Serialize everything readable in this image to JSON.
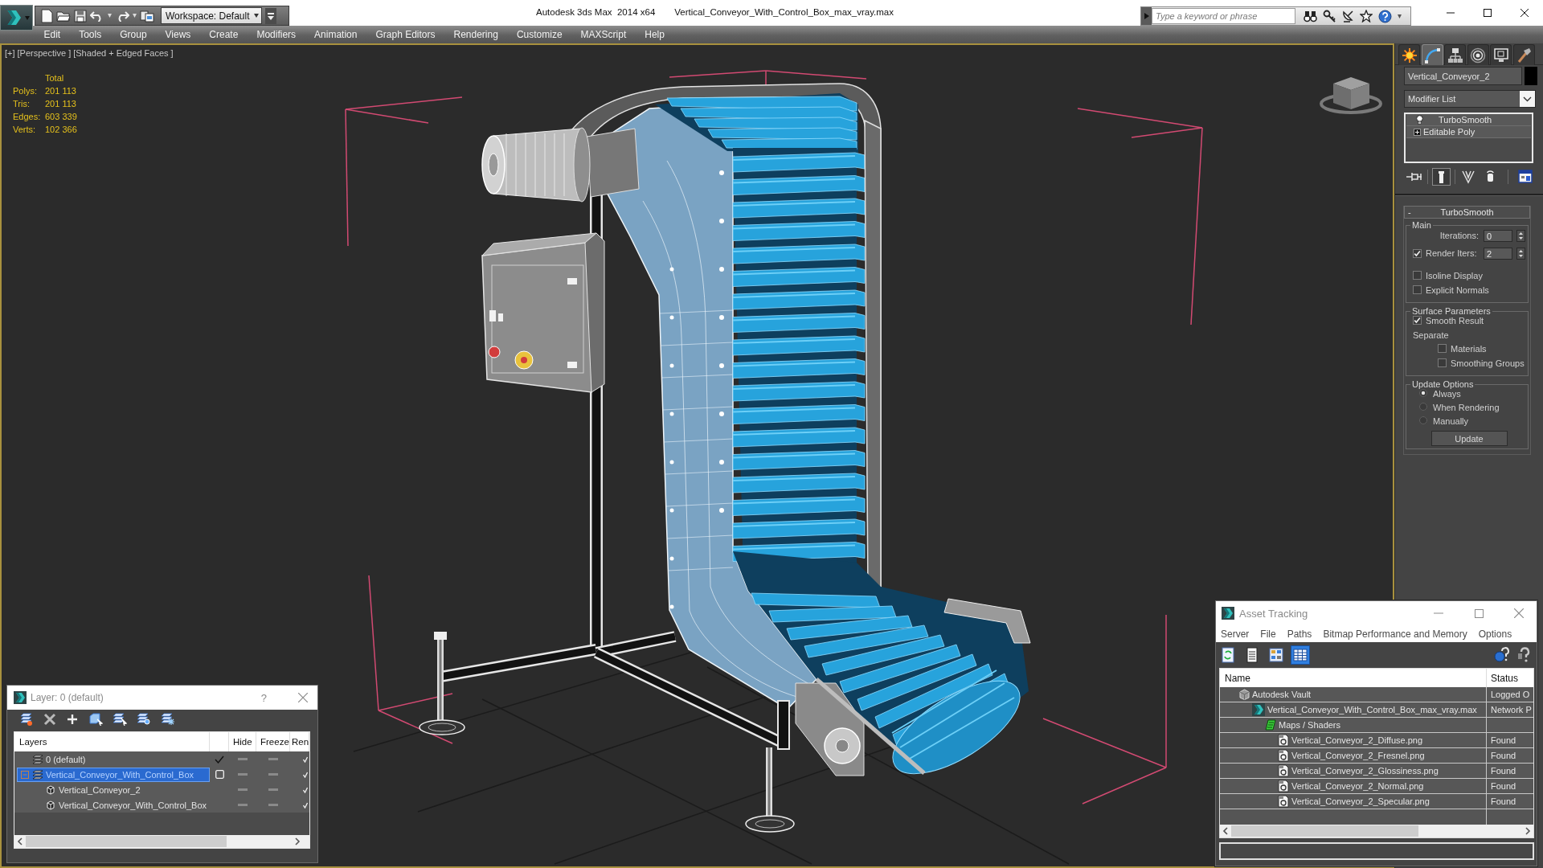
{
  "title_bar": {
    "app_title": "Autodesk 3ds Max  2014 x64",
    "file_name": "Vertical_Conveyor_With_Control_Box_max_vray.max",
    "workspace": "Workspace: Default",
    "search_placeholder": "Type a keyword or phrase"
  },
  "menu": [
    "Edit",
    "Tools",
    "Group",
    "Views",
    "Create",
    "Modifiers",
    "Animation",
    "Graph Editors",
    "Rendering",
    "Customize",
    "MAXScript",
    "Help"
  ],
  "viewport": {
    "active": true,
    "labels": [
      "[+]",
      "[Perspective ]",
      "[Shaded + Edged Faces ]"
    ],
    "stats_header": "Total",
    "stats": [
      {
        "label": "Polys:",
        "value": "201 113"
      },
      {
        "label": "Tris:",
        "value": "201 113"
      },
      {
        "label": "Edges:",
        "value": "603 339"
      },
      {
        "label": "Verts:",
        "value": "102 366"
      }
    ]
  },
  "command_panel": {
    "tabs": [
      {
        "kind": "create",
        "selected": false
      },
      {
        "kind": "modify",
        "selected": true
      },
      {
        "kind": "hierarchy",
        "selected": false
      },
      {
        "kind": "motion",
        "selected": false
      },
      {
        "kind": "display",
        "selected": false
      },
      {
        "kind": "utilities",
        "selected": false
      }
    ],
    "object": {
      "name": "Vertical_Conveyor_2",
      "color": "#000000"
    },
    "modifier_list": "Modifier List",
    "modifier_stack": [
      {
        "name": "TurboSmooth",
        "kind": "modifier",
        "on": true
      },
      {
        "name": "Editable Poly",
        "kind": "base",
        "expanded": false
      }
    ],
    "stack_tools": [
      {
        "kind": "pin",
        "active": false
      },
      {
        "kind": "show_end_result",
        "active": true
      },
      {
        "kind": "make_unique",
        "active": false
      },
      {
        "kind": "remove",
        "active": false
      },
      {
        "kind": "configure",
        "active": false
      }
    ],
    "rollout": {
      "toggle": "-",
      "title": "TurboSmooth",
      "groups": [
        {
          "title": "Main",
          "controls": [
            {
              "kind": "spinner",
              "label": "Iterations:",
              "value": "0"
            },
            {
              "kind": "check_spinner",
              "label": "Render Iters:",
              "checked": true,
              "value": "2"
            },
            {
              "kind": "checkbox",
              "label": "Isoline Display",
              "checked": false
            },
            {
              "kind": "checkbox",
              "label": "Explicit Normals",
              "checked": false
            }
          ]
        },
        {
          "title": "Surface Parameters",
          "controls": [
            {
              "kind": "checkbox",
              "label": "Smooth Result",
              "checked": true
            },
            {
              "kind": "label",
              "label": "Separate",
              "children": [
                {
                  "kind": "checkbox",
                  "label": "Materials",
                  "checked": false
                },
                {
                  "kind": "checkbox",
                  "label": "Smoothing Groups",
                  "checked": false
                }
              ]
            }
          ]
        },
        {
          "title": "Update Options",
          "controls": [
            {
              "kind": "radio",
              "label": "Always",
              "selected": true
            },
            {
              "kind": "radio",
              "label": "When Rendering",
              "selected": false
            },
            {
              "kind": "radio",
              "label": "Manually",
              "selected": false
            },
            {
              "kind": "button",
              "label": "Update"
            }
          ]
        }
      ]
    }
  },
  "layer_dialog": {
    "title": "Layer: 0 (default)",
    "help": "?",
    "columns": [
      "Layers",
      "Hide",
      "Freeze",
      "Ren"
    ],
    "rows": [
      {
        "name": "0 (default)",
        "current": true,
        "selected": false,
        "hidden": false,
        "frozen": false
      },
      {
        "name": "Vertical_Conveyor_With_Control_Box",
        "current": false,
        "selected": true,
        "expanded": true,
        "hidden": false,
        "frozen": false,
        "children": [
          {
            "name": "Vertical_Conveyor_2",
            "selected": false,
            "hidden": false,
            "frozen": false
          },
          {
            "name": "Vertical_Conveyor_With_Control_Box",
            "selected": false,
            "hidden": false,
            "frozen": false
          }
        ]
      }
    ]
  },
  "asset_tracking": {
    "title": "Asset Tracking",
    "menu": [
      "Server",
      "File",
      "Paths",
      "Bitmap Performance and Memory",
      "Options"
    ],
    "tools": [
      {
        "kind": "refresh",
        "selected": false
      },
      {
        "kind": "list",
        "selected": false
      },
      {
        "kind": "thumbnails",
        "selected": false
      },
      {
        "kind": "table",
        "selected": true
      }
    ],
    "columns": [
      "Name",
      "Status"
    ],
    "rows": [
      {
        "name": "Autodesk Vault",
        "kind": "vault",
        "status": "Logged O",
        "children": [
          {
            "name": "Vertical_Conveyor_With_Control_Box_max_vray.max",
            "kind": "scene",
            "status": "Network P",
            "children": [
              {
                "name": "Maps / Shaders",
                "kind": "folder",
                "children": [
                  {
                    "name": "Vertical_Conveyor_2_Diffuse.png",
                    "kind": "bitmap",
                    "status": "Found"
                  },
                  {
                    "name": "Vertical_Conveyor_2_Fresnel.png",
                    "kind": "bitmap",
                    "status": "Found"
                  },
                  {
                    "name": "Vertical_Conveyor_2_Glossiness.png",
                    "kind": "bitmap",
                    "status": "Found"
                  },
                  {
                    "name": "Vertical_Conveyor_2_Normal.png",
                    "kind": "bitmap",
                    "status": "Found"
                  },
                  {
                    "name": "Vertical_Conveyor_2_Specular.png",
                    "kind": "bitmap",
                    "status": "Found"
                  }
                ]
              }
            ]
          }
        ]
      }
    ]
  }
}
